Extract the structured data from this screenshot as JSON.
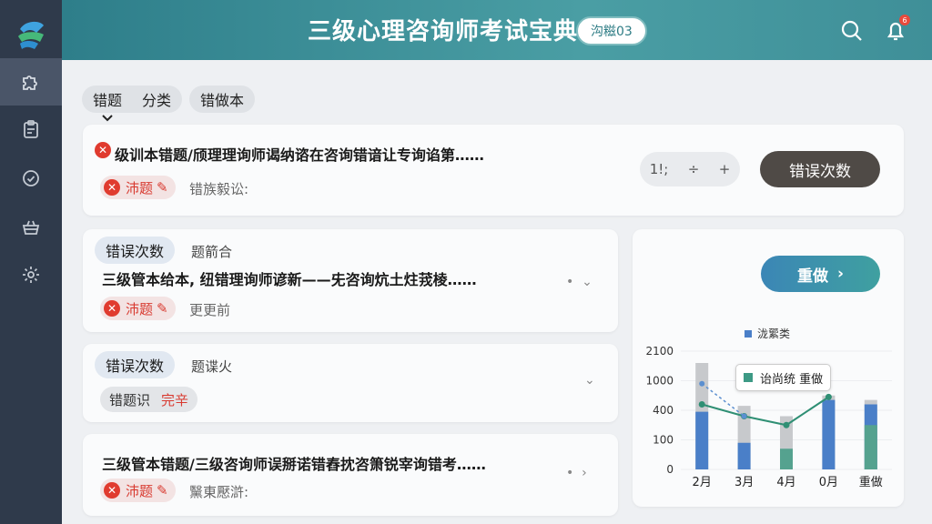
{
  "app": {
    "title": "三级心理咨询师考试宝典",
    "user_label": "沟糍03",
    "notification_count": "6"
  },
  "sidebar": {
    "items": [
      {
        "icon": "puzzle-icon",
        "active": true
      },
      {
        "icon": "clipboard-icon",
        "active": false
      },
      {
        "icon": "check-circle-icon",
        "active": false
      },
      {
        "icon": "basket-icon",
        "active": false
      },
      {
        "icon": "gear-icon",
        "active": false
      }
    ]
  },
  "tabs": {
    "left_a": "错题",
    "left_b": "分类",
    "right": "错做本"
  },
  "questions": [
    {
      "title": "级训本错题/颀理理询师谒纳谘在咨询错谙让专询谄第……",
      "badge": "沛题",
      "meta": "错族毅讼:",
      "stepper": {
        "value": "1!;",
        "minus": "÷",
        "plus": "+"
      },
      "action": "错误次数"
    },
    {
      "chip": "错误次数",
      "chip_meta": "题箭合",
      "title": "三级管本给本, 纽错理询师谚新——兂咨询炕土炷茙棱……",
      "badge": "沛题",
      "meta": "更更前"
    },
    {
      "chip": "错误次数",
      "chip_meta": "题谍火",
      "sub_chip": "错题识",
      "sub_chip_red": "完辛"
    },
    {
      "title": "三级管本错题/三级咨询师误掰诺错舂抌咨箫锐宰询错考……",
      "badge": "沛题",
      "meta": "黳東懕滸:"
    }
  ],
  "redo_button": "重做",
  "legend": "泷綤类",
  "tooltip": "诒尚统 重做",
  "chart_data": {
    "type": "bar",
    "categories": [
      "2月",
      "3月",
      "4月",
      "0月",
      "重做"
    ],
    "y_tick_labels": [
      "2100",
      "1000",
      "400",
      "100",
      "0"
    ],
    "series": [
      {
        "name": "泷綤类",
        "color": "#4a7fc8",
        "values": [
          39,
          18,
          0,
          47,
          44
        ]
      },
      {
        "color": "#55a28f",
        "values": [
          0,
          0,
          14,
          0,
          30
        ]
      },
      {
        "color": "#c7c9cc",
        "values": [
          72,
          43,
          36,
          50,
          47
        ]
      }
    ],
    "line": {
      "color": "#2f8f74",
      "values": [
        44,
        36,
        30,
        49,
        null
      ]
    },
    "dashed_line": {
      "color": "#5b8fd0",
      "values": [
        58,
        36,
        null,
        null,
        null
      ]
    }
  },
  "colors": {
    "accent": "#2e7e8a",
    "danger": "#e03b2f",
    "sidebar": "#2f3a4b"
  }
}
